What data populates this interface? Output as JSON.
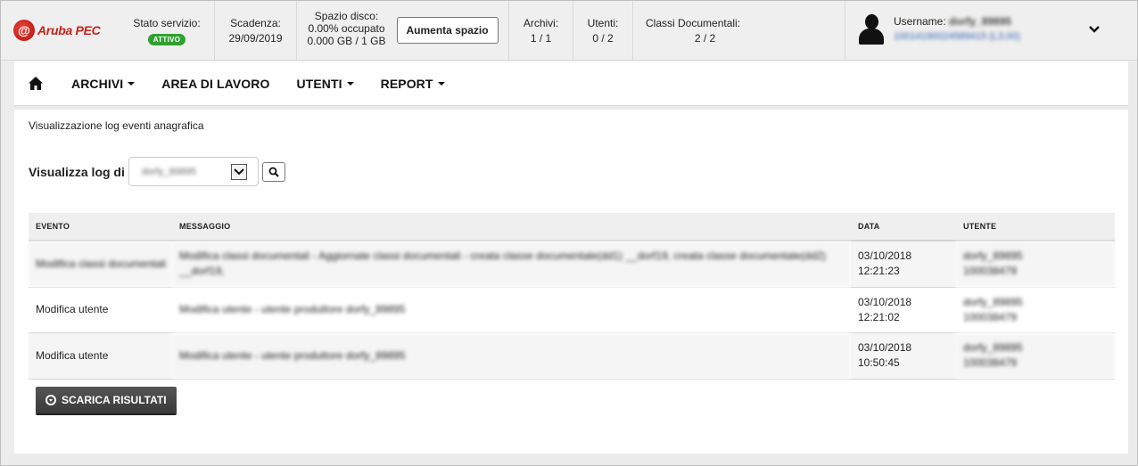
{
  "brand": {
    "logo_mark": "@",
    "name": "Aruba PEC"
  },
  "status": {
    "stato_label": "Stato servizio:",
    "stato_badge": "ATTIVO",
    "scadenza_label": "Scadenza:",
    "scadenza_value": "29/09/2019",
    "spazio_label": "Spazio disco:",
    "spazio_pct": "0.00% occupato",
    "spazio_size": "0.000 GB / 1 GB",
    "aumenta_button": "Aumenta spazio",
    "archivi_label": "Archivi:",
    "archivi_value": "1 / 1",
    "utenti_label": "Utenti:",
    "utenti_value": "0 / 2",
    "classi_label": "Classi Documentali:",
    "classi_value": "2 / 2",
    "badge_color": "#2fa12f"
  },
  "user": {
    "username_label": "Username:",
    "username_value": "dorfy_89895",
    "username_sub": "10014190024589415 (L3.00)",
    "menu_icon": "chevron-down-icon"
  },
  "nav": {
    "home_icon": "home-icon",
    "items": [
      {
        "label": "ARCHIVI",
        "dropdown": true
      },
      {
        "label": "AREA DI LAVORO",
        "dropdown": false
      },
      {
        "label": "UTENTI",
        "dropdown": true
      },
      {
        "label": "REPORT",
        "dropdown": true
      }
    ]
  },
  "page": {
    "title": "Visualizzazione log eventi anagrafica",
    "filter_label": "Visualizza log di",
    "filter_value": "dorfy_89895",
    "search_icon": "search-icon"
  },
  "table": {
    "headers": [
      "EVENTO",
      "MESSAGGIO",
      "DATA",
      "UTENTE"
    ],
    "rows": [
      {
        "evento": "Modifica classi documentali",
        "messaggio": "Modifica classi documentali - Aggiornate classi documentali - creata classe documentale(dd1) __dorf19, creata classe documentale(dd2) __dorf19,",
        "data": "03/10/2018",
        "ora": "12:21:23",
        "utente": "dorfy_89895",
        "utente_sub": "100038479"
      },
      {
        "evento": "Modifica utente",
        "messaggio": "Modifica utente - utente produttore dorfy_89895",
        "data": "03/10/2018",
        "ora": "12:21:02",
        "utente": "dorfy_89895",
        "utente_sub": "100038479"
      },
      {
        "evento": "Modifica utente",
        "messaggio": "Modifica utente - utente produttore dorfy_89895",
        "data": "03/10/2018",
        "ora": "10:50:45",
        "utente": "dorfy_89895",
        "utente_sub": "100038479"
      }
    ]
  },
  "download_button": "SCARICA RISULTATI"
}
